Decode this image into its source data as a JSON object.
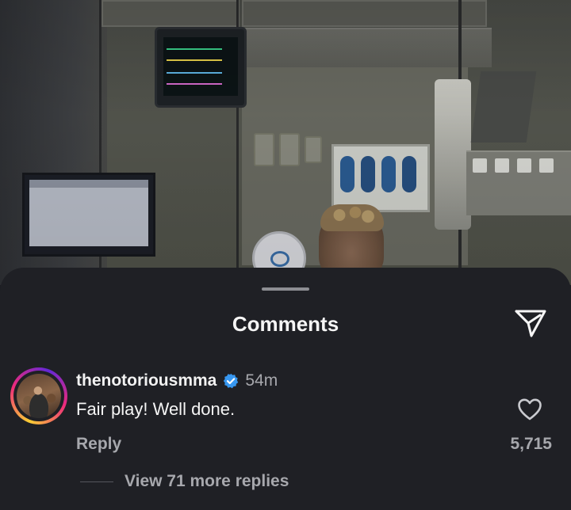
{
  "sheet": {
    "title": "Comments",
    "share_icon": "paper-plane-icon"
  },
  "comment": {
    "username": "thenotoriousmma",
    "verified": true,
    "time": "54m",
    "text": "Fair play! Well done.",
    "reply_label": "Reply",
    "like_count": "5,715",
    "like_icon": "heart-outline-icon",
    "view_replies_label": "View 71 more replies"
  },
  "colors": {
    "sheet_bg": "#1f2025",
    "primary_text": "#f5f5f5",
    "secondary_text": "#a7a8ad",
    "verified_blue": "#3797f0"
  }
}
